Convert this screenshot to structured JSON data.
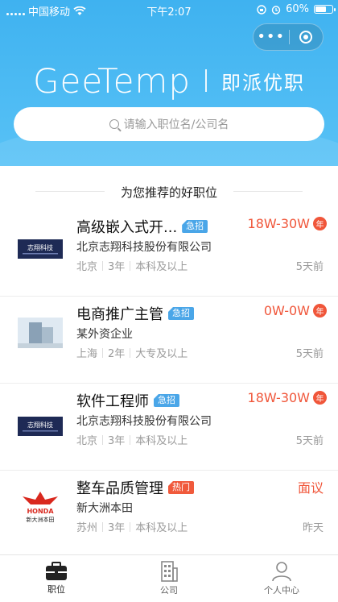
{
  "status_bar": {
    "carrier": "中国移动",
    "time": "下午2:07",
    "battery": "60%"
  },
  "brand": {
    "en": "GeeTemp",
    "cn": "即派优职"
  },
  "search": {
    "placeholder": "请输入职位名/公司名"
  },
  "section_title": "为您推荐的好职位",
  "jobs": [
    {
      "title": "高级嵌入式开...",
      "tag": "急招",
      "salary": "18W-30W",
      "salary_unit": "年",
      "company": "北京志翔科技股份有限公司",
      "city": "北京",
      "experience": "3年",
      "education": "本科及以上",
      "time": "5天前"
    },
    {
      "title": "电商推广主管",
      "tag": "急招",
      "salary": "0W-0W",
      "salary_unit": "年",
      "company": "某外资企业",
      "city": "上海",
      "experience": "2年",
      "education": "大专及以上",
      "time": "5天前"
    },
    {
      "title": "软件工程师",
      "tag": "急招",
      "salary": "18W-30W",
      "salary_unit": "年",
      "company": "北京志翔科技股份有限公司",
      "city": "北京",
      "experience": "3年",
      "education": "本科及以上",
      "time": "5天前"
    },
    {
      "title": "整车品质管理",
      "tag": "热门",
      "salary": "面议",
      "company": "新大洲本田",
      "city": "苏州",
      "experience": "3年",
      "education": "本科及以上",
      "time": "昨天"
    }
  ],
  "logos": {
    "zhixiang": "志翔科技",
    "honda": "HONDA",
    "honda_cn": "新大洲本田"
  },
  "tabbar": [
    {
      "label": "职位",
      "icon": "briefcase-icon"
    },
    {
      "label": "公司",
      "icon": "building-icon"
    },
    {
      "label": "个人中心",
      "icon": "person-icon"
    }
  ],
  "colors": {
    "header_blue": "#3fb2f0",
    "accent_red": "#f0563a",
    "tag_blue": "#4aa6e8"
  }
}
